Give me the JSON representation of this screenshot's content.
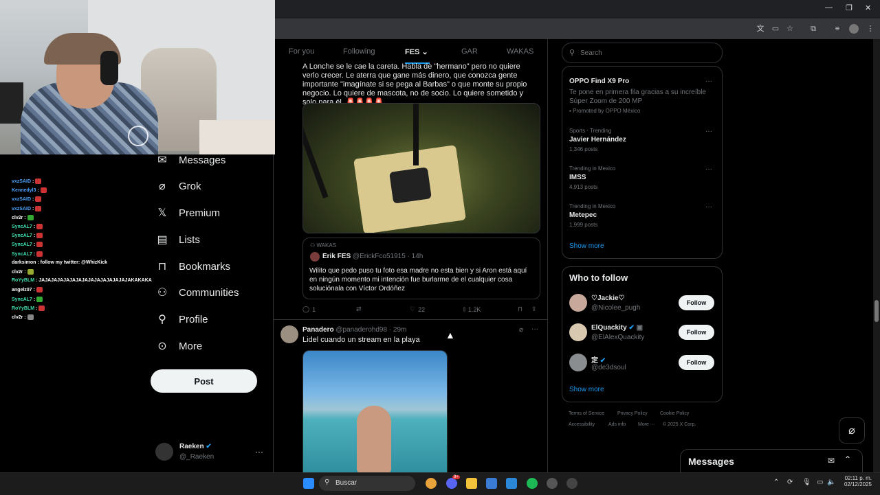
{
  "chat": {
    "lines": [
      {
        "user": "vxzSAID",
        "color": "#4aa3ff",
        "msg": " :"
      },
      {
        "user": "Kennedyl3",
        "color": "#4aa3ff",
        "msg": " :"
      },
      {
        "user": "vxzSAID",
        "color": "#4aa3ff",
        "msg": " :"
      },
      {
        "user": "vxzSAID",
        "color": "#4aa3ff",
        "msg": " :"
      },
      {
        "user": "clv2r",
        "color": "#ffffff",
        "msg": " :"
      },
      {
        "user": "SyncAL7",
        "color": "#3ee0b0",
        "msg": " :"
      },
      {
        "user": "SyncAL7",
        "color": "#3ee0b0",
        "msg": " :"
      },
      {
        "user": "SyncAL7",
        "color": "#3ee0b0",
        "msg": " :"
      },
      {
        "user": "SyncAL7",
        "color": "#3ee0b0",
        "msg": " :"
      },
      {
        "user": "darksimon",
        "color": "#ffffff",
        "msg": " : follow my twitter: @WhizKick"
      },
      {
        "user": "clv2r",
        "color": "#ffffff",
        "msg": " :"
      },
      {
        "user": "RoYyBLM",
        "color": "#3ee0b0",
        "msg": " : JAJAJAJAJAJAJAJAJAJAJAJAJAJAJAKAKAKA"
      },
      {
        "user": "angelz07",
        "color": "#ffffff",
        "msg": " :"
      },
      {
        "user": "SyncAL7",
        "color": "#3ee0b0",
        "msg": " :"
      },
      {
        "user": "RoYyBLM",
        "color": "#3ee0b0",
        "msg": " :"
      },
      {
        "user": "clv2r",
        "color": "#ffffff",
        "msg": " :"
      }
    ]
  },
  "nav": {
    "messages": "Messages",
    "grok": "Grok",
    "premium": "Premium",
    "lists": "Lists",
    "bookmarks": "Bookmarks",
    "communities": "Communities",
    "profile": "Profile",
    "more": "More",
    "post": "Post"
  },
  "account": {
    "name": "Raeken",
    "handle": "@_Raeken"
  },
  "tabs": [
    "For you",
    "Following",
    "FES",
    "GAR",
    "WAKAS"
  ],
  "tweet1": {
    "text": "A Lonche se le cae la careta. Habla de \"hermano\" pero no quiere verlo crecer. Le aterra que gane más dinero, que conozca gente importante \"imagínate si se pega al Barbas\" o que monte su propio negocio. Lo quiere de mascota, no de socio. Lo quiere sometido y solo para él. 🚨🚨🚨🚨",
    "quote_community": "WAKAS",
    "quote_name": "Erik FES",
    "quote_meta": "@ErickFco51915 · 14h",
    "quote_text": "Wilito que pedo puso tu foto esa madre no esta bien y si Aron está aquí en ningún momento mi intención fue burlarme de el cualquier cosa soluciónala con Víctor Ordóñez",
    "replies": "1",
    "likes": "22",
    "views": "1.2K"
  },
  "tweet2": {
    "name": "Panadero",
    "meta": "@panaderohd98 · 29m",
    "text": "Lidel cuando un stream en la playa"
  },
  "search": {
    "placeholder": "Search"
  },
  "trends": [
    {
      "meta": "",
      "name": "OPPO Find X9 Pro",
      "desc": "Te pone en primera fila gracias a su increíble Súper Zoom de 200 MP",
      "promo": "Promoted by OPPO México"
    },
    {
      "meta": "Sports · Trending",
      "name": "Javier Hernández",
      "posts": "1,346 posts"
    },
    {
      "meta": "Trending in Mexico",
      "name": "IMSS",
      "posts": "4,913 posts"
    },
    {
      "meta": "Trending in Mexico",
      "name": "Metepec",
      "posts": "1,999 posts"
    }
  ],
  "show_more": "Show more",
  "who_to_follow": {
    "title": "Who to follow",
    "users": [
      {
        "name": "♡Jackie♡",
        "handle": "@Nicolee_pugh"
      },
      {
        "name": "ElQuackity",
        "handle": "@ElAlexQuackity"
      },
      {
        "name": "定",
        "handle": "@de3dsoul"
      }
    ],
    "follow": "Follow"
  },
  "footer": [
    "Terms of Service",
    "Privacy Policy",
    "Cookie Policy",
    "Accessibility",
    "Ads info",
    "More ···",
    "© 2025 X Corp."
  ],
  "messages_drawer": "Messages",
  "taskbar": {
    "search": "Buscar",
    "time": "02:11 p. m.",
    "date": "02/12/2025",
    "badge": "9+"
  },
  "colors": {
    "accent": "#1d9bf0",
    "bg": "#000000"
  }
}
